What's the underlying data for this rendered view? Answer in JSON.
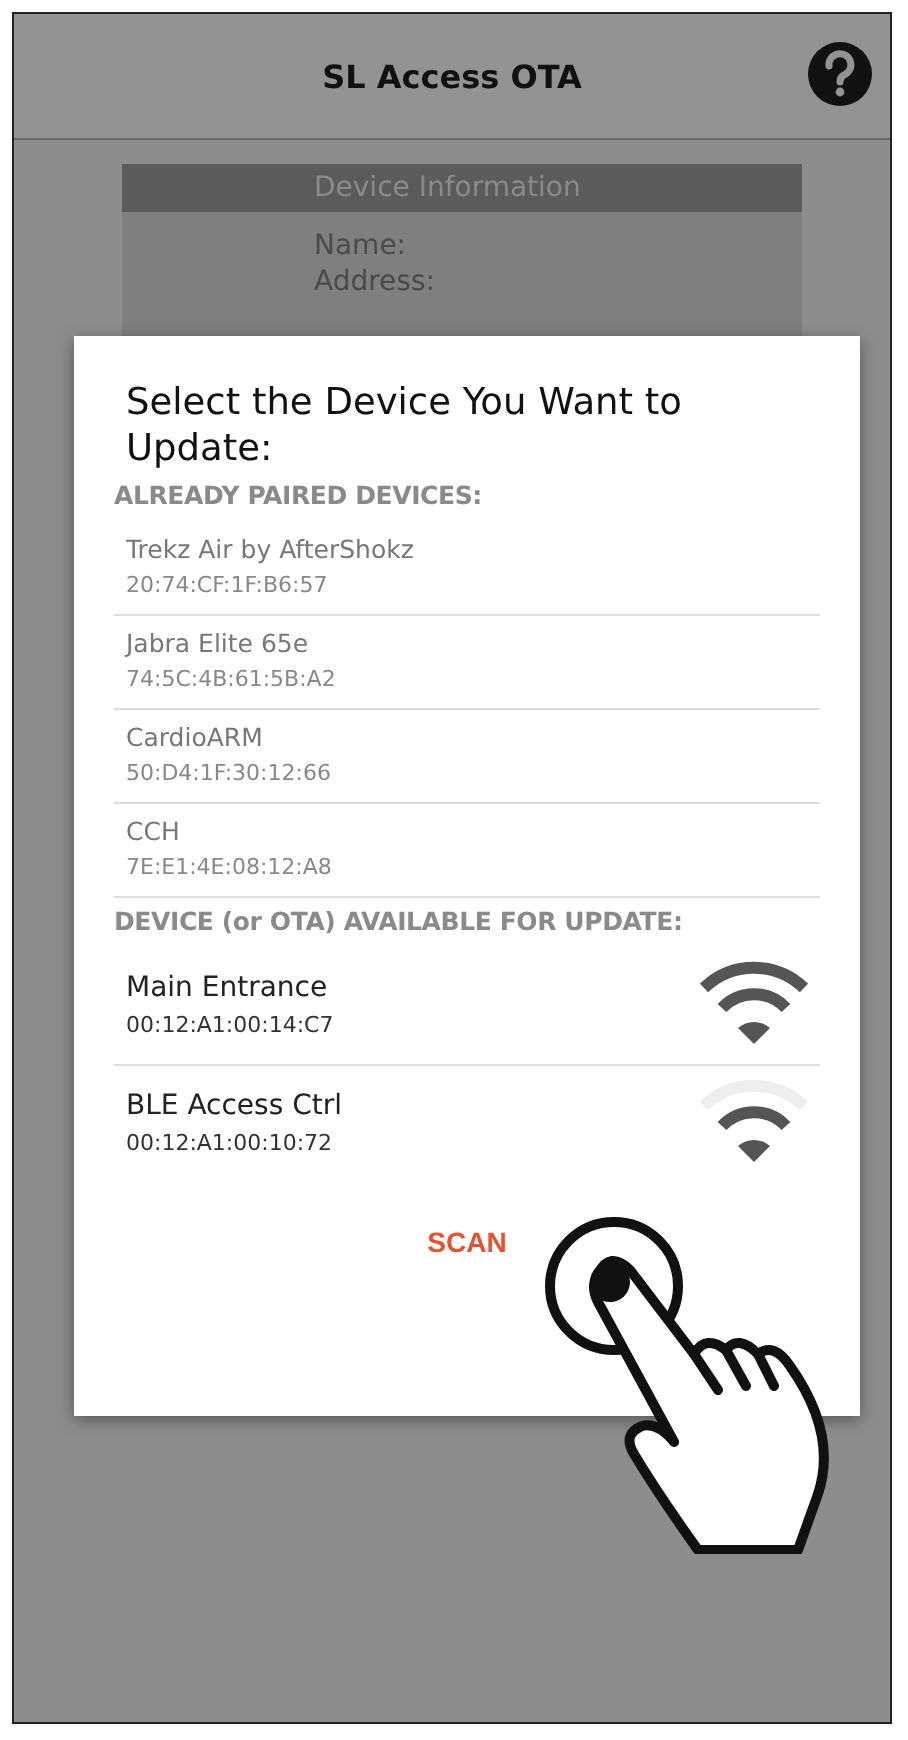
{
  "app_bar": {
    "title": "SL Access OTA"
  },
  "device_information": {
    "title": "Device Information",
    "fields": [
      "Name:",
      "Address:"
    ]
  },
  "dialog": {
    "title": "Select the Device You Want to Update:",
    "paired_heading": "ALREADY PAIRED DEVICES:",
    "paired_devices": [
      {
        "name": "Trekz Air by AfterShokz",
        "address": "20:74:CF:1F:B6:57"
      },
      {
        "name": "Jabra Elite 65e",
        "address": "74:5C:4B:61:5B:A2"
      },
      {
        "name": "CardioARM",
        "address": "50:D4:1F:30:12:66"
      },
      {
        "name": "CCH",
        "address": "7E:E1:4E:08:12:A8"
      }
    ],
    "available_heading": "DEVICE (or OTA) AVAILABLE FOR UPDATE:",
    "available_devices": [
      {
        "name": "Main Entrance",
        "address": "00:12:A1:00:14:C7",
        "kind": "strong"
      },
      {
        "name": "BLE Access Ctrl",
        "address": "00:12:A1:00:10:72",
        "kind": "weak"
      }
    ],
    "button": "SCAN"
  }
}
